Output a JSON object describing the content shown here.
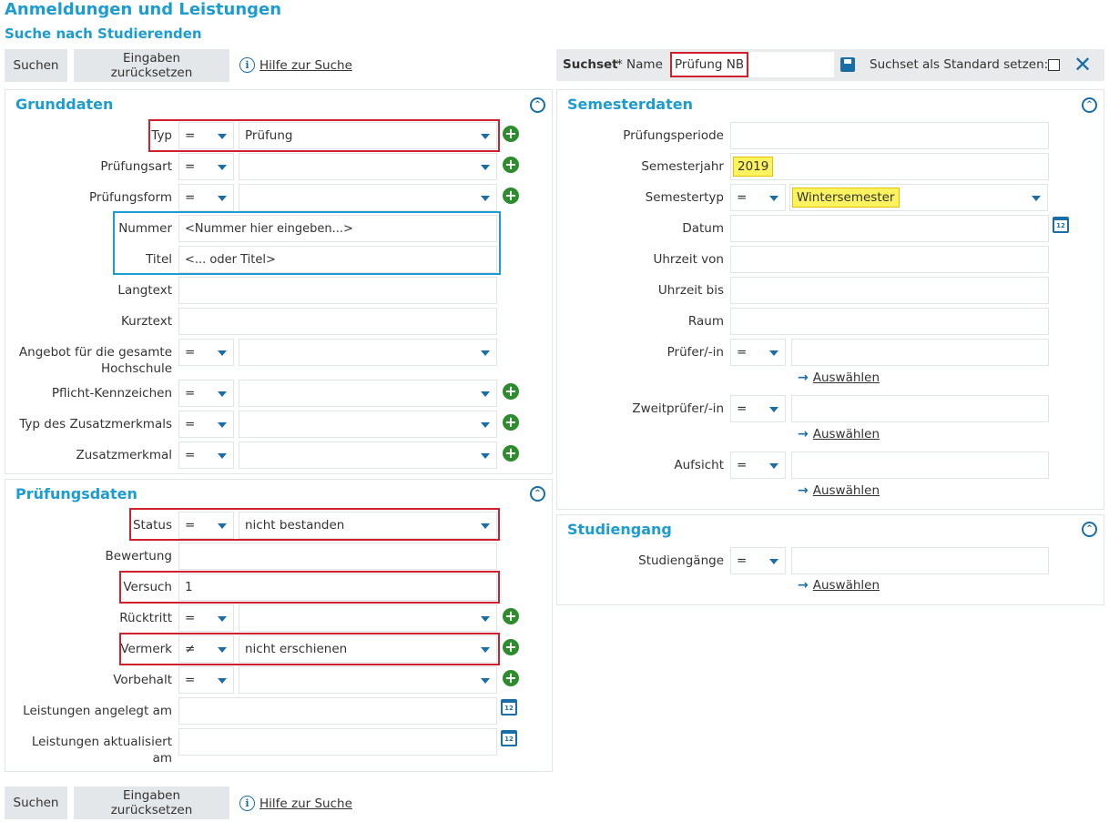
{
  "header": {
    "title": "Anmeldungen und Leistungen",
    "subtitle": "Suche nach Studierenden"
  },
  "toolbar": {
    "search": "Suchen",
    "reset": "Eingaben zurücksetzen",
    "help": "Hilfe zur Suche"
  },
  "suchset": {
    "label": "Suchset",
    "name_label": "* Name",
    "name_value": "Prüfung NB",
    "default_label": "Suchset als Standard setzen:"
  },
  "grunddaten": {
    "title": "Grunddaten",
    "typ": {
      "label": "Typ",
      "op": "=",
      "value": "Prüfung"
    },
    "pruefungsart": {
      "label": "Prüfungsart",
      "op": "=",
      "value": ""
    },
    "pruefungsform": {
      "label": "Prüfungsform",
      "op": "=",
      "value": ""
    },
    "nummer": {
      "label": "Nummer",
      "placeholder": "<Nummer hier eingeben...>"
    },
    "titel": {
      "label": "Titel",
      "placeholder": "<... oder Titel>"
    },
    "langtext": {
      "label": "Langtext"
    },
    "kurztext": {
      "label": "Kurztext"
    },
    "angebot": {
      "label1": "Angebot für die gesamte",
      "label2": "Hochschule",
      "op": "="
    },
    "pflicht": {
      "label": "Pflicht-Kennzeichen",
      "op": "="
    },
    "typzusatz": {
      "label": "Typ des Zusatzmerkmals",
      "op": "="
    },
    "zusatz": {
      "label": "Zusatzmerkmal",
      "op": "="
    }
  },
  "pruefungsdaten": {
    "title": "Prüfungsdaten",
    "status": {
      "label": "Status",
      "op": "=",
      "value": "nicht bestanden"
    },
    "bewertung": {
      "label": "Bewertung"
    },
    "versuch": {
      "label": "Versuch",
      "value": "1"
    },
    "ruecktritt": {
      "label": "Rücktritt",
      "op": "="
    },
    "vermerk": {
      "label": "Vermerk",
      "op": "≠",
      "value": "nicht erschienen"
    },
    "vorbehalt": {
      "label": "Vorbehalt",
      "op": "="
    },
    "angelegt": {
      "label": "Leistungen angelegt am"
    },
    "aktualisiert": {
      "label1": "Leistungen aktualisiert",
      "label2": "am"
    }
  },
  "semesterdaten": {
    "title": "Semesterdaten",
    "periode": {
      "label": "Prüfungsperiode"
    },
    "jahr": {
      "label": "Semesterjahr",
      "value": "2019"
    },
    "typ": {
      "label": "Semestertyp",
      "op": "=",
      "value": "Wintersemester"
    },
    "datum": {
      "label": "Datum"
    },
    "von": {
      "label": "Uhrzeit von"
    },
    "bis": {
      "label": "Uhrzeit bis"
    },
    "raum": {
      "label": "Raum"
    },
    "pruefer": {
      "label": "Prüfer/-in",
      "op": "="
    },
    "zweitpruefer": {
      "label": "Zweitprüfer/-in",
      "op": "="
    },
    "aufsicht": {
      "label": "Aufsicht",
      "op": "="
    },
    "select_link": "Auswählen"
  },
  "studiengang": {
    "title": "Studiengang",
    "studiengaenge": {
      "label": "Studiengänge",
      "op": "="
    }
  },
  "icons": {
    "info": "info-icon",
    "collapse": "collapse-icon",
    "plus": "plus-icon",
    "calendar": "calendar-icon",
    "save": "save-icon",
    "close": "close-icon",
    "arrow": "arrow-right-icon",
    "caret": "caret-down-icon"
  },
  "colors": {
    "accent": "#1c9cd0",
    "icon": "#1a6ea8",
    "highlight_red": "#d0202e",
    "plus_green": "#2e8b2e",
    "yellow": "#fcf35e"
  }
}
